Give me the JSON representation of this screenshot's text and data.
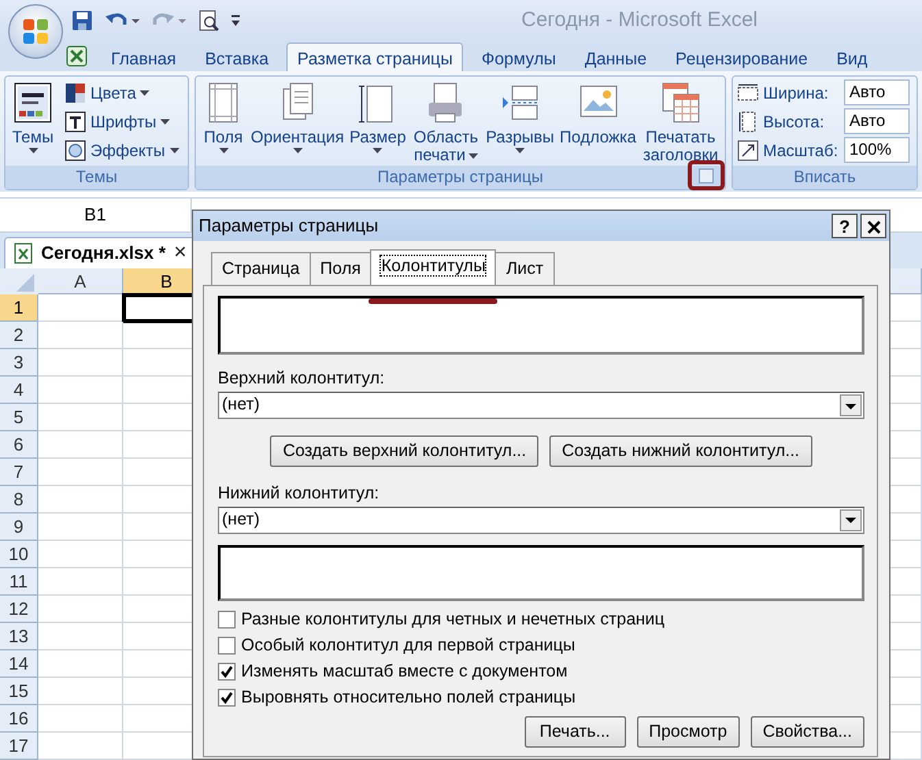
{
  "window": {
    "title": "Сегодня - Microsoft Excel"
  },
  "ribbon_tabs": [
    {
      "label": "Главная",
      "selected": false
    },
    {
      "label": "Вставка",
      "selected": false
    },
    {
      "label": "Разметка страницы",
      "selected": true
    },
    {
      "label": "Формулы",
      "selected": false
    },
    {
      "label": "Данные",
      "selected": false
    },
    {
      "label": "Рецензирование",
      "selected": false
    },
    {
      "label": "Вид",
      "selected": false
    }
  ],
  "ribbon_groups": [
    {
      "label": "Темы",
      "items": [
        {
          "kind": "large",
          "label": "Темы",
          "dropdown": true
        },
        {
          "kind": "small",
          "label": "Цвета",
          "dropdown": true
        },
        {
          "kind": "small",
          "label": "Шрифты",
          "dropdown": true
        },
        {
          "kind": "small",
          "label": "Эффекты",
          "dropdown": true
        }
      ]
    },
    {
      "label": "Параметры страницы",
      "launcher": {
        "highlighted": true
      },
      "items": [
        {
          "kind": "large",
          "label": "Поля",
          "dropdown": true
        },
        {
          "kind": "large",
          "label": "Ориентация",
          "dropdown": true
        },
        {
          "kind": "large",
          "label": "Размер",
          "dropdown": true
        },
        {
          "kind": "large",
          "label": "Область печати",
          "dropdown": true
        },
        {
          "kind": "large",
          "label": "Разрывы",
          "dropdown": true
        },
        {
          "kind": "large",
          "label": "Подложка",
          "dropdown": false
        },
        {
          "kind": "large",
          "label": "Печатать заголовки",
          "dropdown": false
        }
      ]
    },
    {
      "label": "Вписать",
      "items": [
        {
          "kind": "field",
          "label": "Ширина:",
          "value": "Авто"
        },
        {
          "kind": "field",
          "label": "Высота:",
          "value": "Авто"
        },
        {
          "kind": "field",
          "label": "Масштаб:",
          "value": "100%"
        }
      ]
    }
  ],
  "name_box": "B1",
  "workbook_tab": {
    "label": "Сегодня.xlsx *",
    "close": "×"
  },
  "sheet": {
    "columns": [
      {
        "label": "A",
        "selected": false
      },
      {
        "label": "B",
        "selected": true
      }
    ],
    "rows": [
      {
        "label": "1",
        "selected": true
      },
      {
        "label": "2",
        "selected": false
      },
      {
        "label": "3",
        "selected": false
      },
      {
        "label": "4",
        "selected": false
      },
      {
        "label": "5",
        "selected": false
      },
      {
        "label": "6",
        "selected": false
      },
      {
        "label": "7",
        "selected": false
      },
      {
        "label": "8",
        "selected": false
      },
      {
        "label": "9",
        "selected": false
      },
      {
        "label": "10",
        "selected": false
      },
      {
        "label": "11",
        "selected": false
      },
      {
        "label": "12",
        "selected": false
      },
      {
        "label": "13",
        "selected": false
      },
      {
        "label": "14",
        "selected": false
      },
      {
        "label": "15",
        "selected": false
      },
      {
        "label": "16",
        "selected": false
      },
      {
        "label": "17",
        "selected": false
      }
    ]
  },
  "dialog": {
    "title": "Параметры страницы",
    "help": "?",
    "tabs": [
      {
        "label": "Страница",
        "selected": false,
        "highlighted": false
      },
      {
        "label": "Поля",
        "selected": false,
        "highlighted": false
      },
      {
        "label": "Колонтитулы",
        "selected": true,
        "highlighted": true
      },
      {
        "label": "Лист",
        "selected": false,
        "highlighted": false
      }
    ],
    "header_label": "Верхний колонтитул:",
    "header_value": "(нет)",
    "create_buttons": [
      "Создать верхний колонтитул...",
      "Создать нижний колонтитул..."
    ],
    "footer_label": "Нижний колонтитул:",
    "footer_value": "(нет)",
    "options": [
      {
        "label": "Разные колонтитулы для четных и нечетных страниц",
        "checked": false
      },
      {
        "label": "Особый колонтитул для первой страницы",
        "checked": false
      },
      {
        "label": "Изменять масштаб вместе с документом",
        "checked": true
      },
      {
        "label": "Выровнять относительно полей страницы",
        "checked": true
      }
    ],
    "buttons": [
      "Печать...",
      "Просмотр",
      "Свойства..."
    ]
  }
}
